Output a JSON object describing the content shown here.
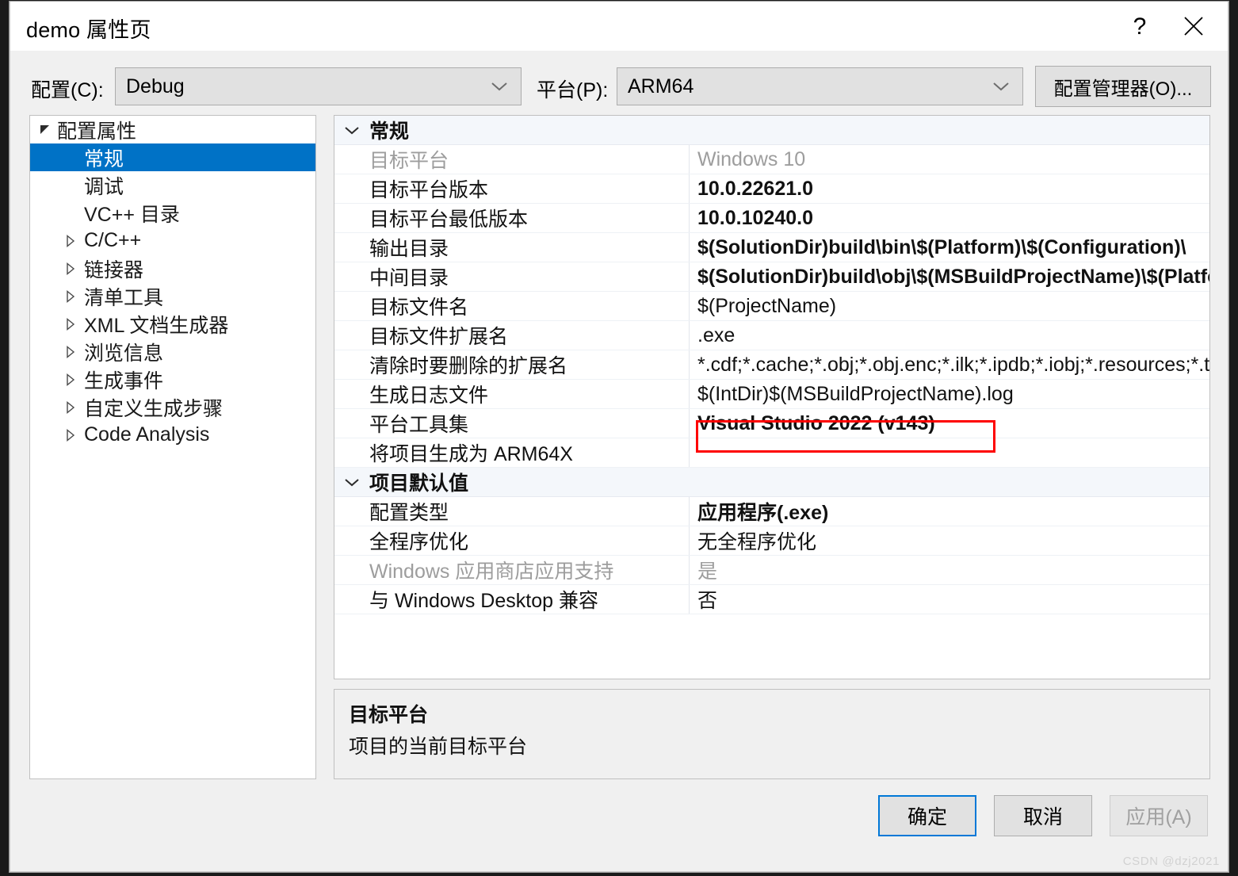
{
  "window": {
    "title": "demo 属性页",
    "help_icon": "question-mark-icon",
    "close_icon": "close-icon"
  },
  "configbar": {
    "config_label": "配置(C):",
    "config_value": "Debug",
    "platform_label": "平台(P):",
    "platform_value": "ARM64",
    "config_manager_button": "配置管理器(O)...",
    "dropdown_icon": "chevron-down-icon"
  },
  "tree": {
    "items": [
      {
        "label": "配置属性",
        "level": 0,
        "expander": "triangle-expanded-icon",
        "selected": false
      },
      {
        "label": "常规",
        "level": 1,
        "expander": "none",
        "selected": true
      },
      {
        "label": "调试",
        "level": 1,
        "expander": "none",
        "selected": false
      },
      {
        "label": "VC++ 目录",
        "level": 1,
        "expander": "none",
        "selected": false
      },
      {
        "label": "C/C++",
        "level": 1,
        "expander": "triangle-collapsed-icon",
        "selected": false
      },
      {
        "label": "链接器",
        "level": 1,
        "expander": "triangle-collapsed-icon",
        "selected": false
      },
      {
        "label": "清单工具",
        "level": 1,
        "expander": "triangle-collapsed-icon",
        "selected": false
      },
      {
        "label": "XML 文档生成器",
        "level": 1,
        "expander": "triangle-collapsed-icon",
        "selected": false
      },
      {
        "label": "浏览信息",
        "level": 1,
        "expander": "triangle-collapsed-icon",
        "selected": false
      },
      {
        "label": "生成事件",
        "level": 1,
        "expander": "triangle-collapsed-icon",
        "selected": false
      },
      {
        "label": "自定义生成步骤",
        "level": 1,
        "expander": "triangle-collapsed-icon",
        "selected": false
      },
      {
        "label": "Code Analysis",
        "level": 1,
        "expander": "triangle-collapsed-icon",
        "selected": false
      }
    ]
  },
  "grid": {
    "sections": [
      {
        "title": "常规",
        "chevron": "chevron-down-icon",
        "rows": [
          {
            "name": "目标平台",
            "value": "Windows 10",
            "dim": true,
            "bold": false
          },
          {
            "name": "目标平台版本",
            "value": "10.0.22621.0",
            "dim": false,
            "bold": true
          },
          {
            "name": "目标平台最低版本",
            "value": "10.0.10240.0",
            "dim": false,
            "bold": true
          },
          {
            "name": "输出目录",
            "value": "$(SolutionDir)build\\bin\\$(Platform)\\$(Configuration)\\",
            "dim": false,
            "bold": true
          },
          {
            "name": "中间目录",
            "value": "$(SolutionDir)build\\obj\\$(MSBuildProjectName)\\$(Platform)\\$(Configuration)\\",
            "dim": false,
            "bold": true
          },
          {
            "name": "目标文件名",
            "value": "$(ProjectName)",
            "dim": false,
            "bold": false
          },
          {
            "name": "目标文件扩展名",
            "value": ".exe",
            "dim": false,
            "bold": false
          },
          {
            "name": "清除时要删除的扩展名",
            "value": "*.cdf;*.cache;*.obj;*.obj.enc;*.ilk;*.ipdb;*.iobj;*.resources;*.tlb;*.tli;*.tlh;*.tmp",
            "dim": false,
            "bold": false
          },
          {
            "name": "生成日志文件",
            "value": "$(IntDir)$(MSBuildProjectName).log",
            "dim": false,
            "bold": false
          },
          {
            "name": "平台工具集",
            "value": "Visual Studio 2022 (v143)",
            "dim": false,
            "bold": true,
            "highlighted": true
          },
          {
            "name": "将项目生成为 ARM64X",
            "value": "",
            "dim": false,
            "bold": false
          }
        ]
      },
      {
        "title": "项目默认值",
        "chevron": "chevron-down-icon",
        "rows": [
          {
            "name": "配置类型",
            "value": "应用程序(.exe)",
            "dim": false,
            "bold": true
          },
          {
            "name": "全程序优化",
            "value": "无全程序优化",
            "dim": false,
            "bold": false
          },
          {
            "name": "Windows 应用商店应用支持",
            "value": "是",
            "dim": true,
            "bold": false
          },
          {
            "name": "与 Windows Desktop 兼容",
            "value": "否",
            "dim": false,
            "bold": false
          }
        ]
      }
    ],
    "highlight_color": "#fe0000"
  },
  "description": {
    "title": "目标平台",
    "body": "项目的当前目标平台"
  },
  "footer": {
    "ok": "确定",
    "cancel": "取消",
    "apply": "应用(A)",
    "accent_color": "#0078d7"
  },
  "watermark": {
    "text": "CSDN @dzj2021"
  }
}
